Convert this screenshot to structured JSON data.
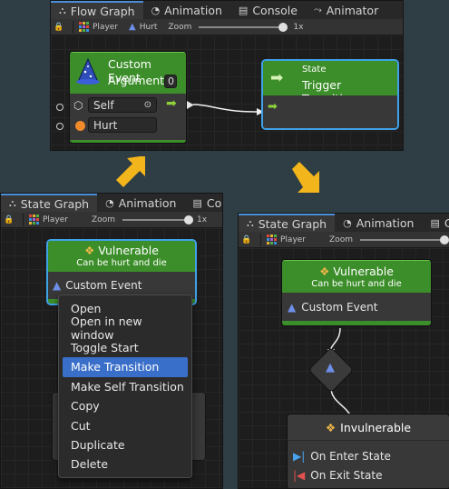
{
  "panel1": {
    "tabs": [
      {
        "label": "Flow Graph",
        "icon": "hierarchy-icon"
      },
      {
        "label": "Animation",
        "icon": "clock-icon"
      },
      {
        "label": "Console",
        "icon": "console-icon"
      },
      {
        "label": "Animator",
        "icon": "animator-icon"
      }
    ],
    "toolbar": {
      "player": "Player",
      "hurt": "Hurt",
      "zoom": "Zoom",
      "zoom_value": "1x"
    },
    "event_node": {
      "title": "Custom Event",
      "arguments_label": "Arguments",
      "arguments_count": "0",
      "self_value": "Self",
      "event_name": "Hurt"
    },
    "state_node": {
      "subtitle": "State",
      "title": "Trigger Transition"
    }
  },
  "panel2": {
    "tabs": [
      {
        "label": "State Graph",
        "icon": "hierarchy-icon"
      },
      {
        "label": "Animation",
        "icon": "clock-icon"
      },
      {
        "label": "Co",
        "icon": "console-icon"
      }
    ],
    "toolbar": {
      "player": "Player",
      "zoom": "Zoom",
      "zoom_value": "1x"
    },
    "node": {
      "title": "Vulnerable",
      "subtitle": "Can be hurt and die",
      "row": "Custom Event"
    },
    "menu": [
      "Open",
      "Open in new window",
      "Toggle Start",
      "Make Transition",
      "Make Self Transition",
      "Copy",
      "Cut",
      "Duplicate",
      "Delete"
    ],
    "menu_highlighted": "Make Transition"
  },
  "panel3": {
    "tabs": [
      {
        "label": "State Graph",
        "icon": "hierarchy-icon"
      },
      {
        "label": "Animation",
        "icon": "clock-icon"
      },
      {
        "label": "C",
        "icon": "console-icon"
      }
    ],
    "toolbar": {
      "player": "Player",
      "zoom": "Zoom"
    },
    "vulnerable": {
      "title": "Vulnerable",
      "subtitle": "Can be hurt and die",
      "row": "Custom Event"
    },
    "invulnerable": {
      "title": "Invulnerable",
      "rows": [
        "On Enter State",
        "On Exit State"
      ]
    }
  },
  "colors": {
    "accent_arrow": "#f2b51b",
    "node_green": "#3c8e2a",
    "highlight": "#3a6fc9",
    "tab_active": "#4b8ed8"
  }
}
